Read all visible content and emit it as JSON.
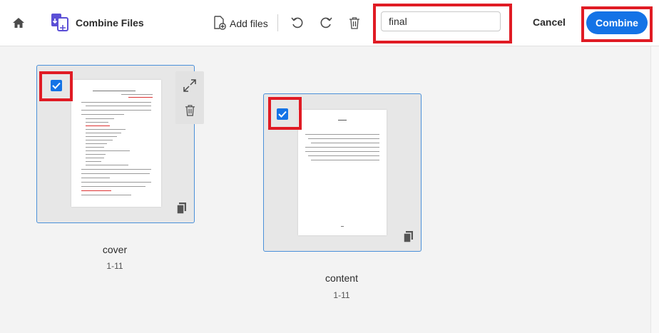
{
  "toolbar": {
    "title": "Combine Files",
    "add_files_label": "Add files",
    "file_name_value": "final",
    "cancel_label": "Cancel",
    "combine_label": "Combine"
  },
  "files": [
    {
      "name": "cover",
      "pages": "1-11"
    },
    {
      "name": "content",
      "pages": "1-11"
    }
  ],
  "colors": {
    "accent": "#1473e6",
    "highlight": "#e01b24",
    "card_border": "#4a90d9"
  }
}
